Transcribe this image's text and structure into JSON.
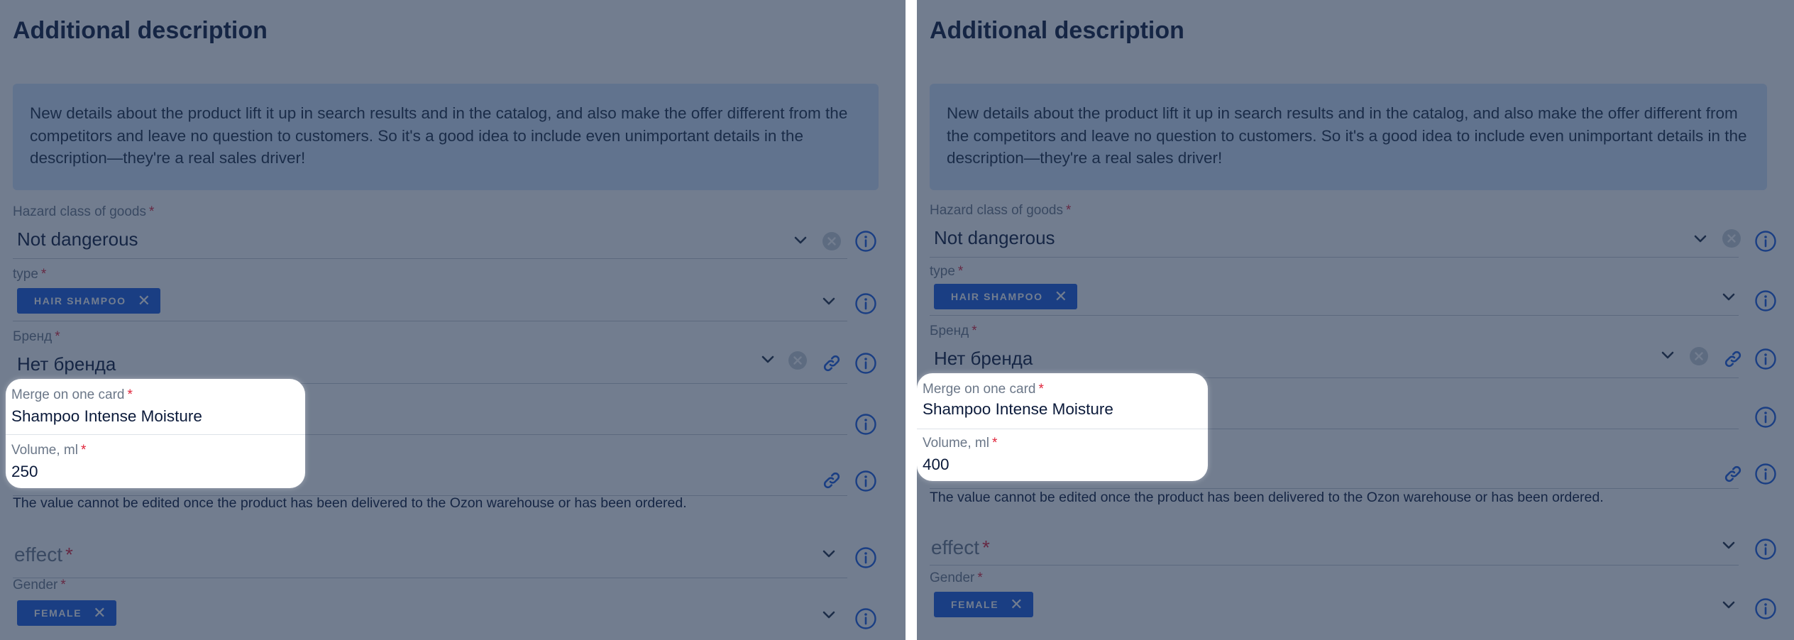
{
  "panels": [
    {
      "title": "Additional description",
      "info_text": "New details about the product lift it up in search results and in the catalog, and also make the offer different from the competitors and leave no question to customers. So it's a good idea to include even unimportant details in the description—they're a real sales driver!",
      "hazard": {
        "label": "Hazard class of goods",
        "value": "Not dangerous"
      },
      "type": {
        "label": "type",
        "chip": "HAIR SHAMPOO"
      },
      "brand": {
        "label": "Бренд",
        "value": "Нет бренда"
      },
      "merge": {
        "label": "Merge on one card",
        "value": "Shampoo Intense Moisture"
      },
      "volume": {
        "label": "Volume, ml",
        "value": "250"
      },
      "hint": "The value cannot be edited once the product has been delivered to the Ozon warehouse or has been ordered.",
      "effect": {
        "placeholder": "effect"
      },
      "gender": {
        "label": "Gender",
        "chip": "FEMALE"
      }
    },
    {
      "title": "Additional description",
      "info_text": "New details about the product lift it up in search results and in the catalog, and also make the offer different from the competitors and leave no question to customers. So it's a good idea to include even unimportant details in the description—they're a real sales driver!",
      "hazard": {
        "label": "Hazard class of goods",
        "value": "Not dangerous"
      },
      "type": {
        "label": "type",
        "chip": "HAIR SHAMPOO"
      },
      "brand": {
        "label": "Бренд",
        "value": "Нет бренда"
      },
      "merge": {
        "label": "Merge on one card",
        "value": "Shampoo Intense Moisture"
      },
      "volume": {
        "label": "Volume, ml",
        "value": "400"
      },
      "hint": "The value cannot be edited once the product has been delivered to the Ozon warehouse or has been ordered.",
      "effect": {
        "placeholder": "effect"
      },
      "gender": {
        "label": "Gender",
        "chip": "FEMALE"
      }
    }
  ],
  "required_mark": "*",
  "chip_remove_glyph": "✕",
  "colors": {
    "accent": "#1a5be0",
    "required": "#e0243a",
    "overlay": "#1c2d4a",
    "info_box": "#d3e4fb"
  },
  "icons": [
    "chevron-down-icon",
    "clear-icon",
    "info-icon",
    "link-icon",
    "remove-icon"
  ]
}
